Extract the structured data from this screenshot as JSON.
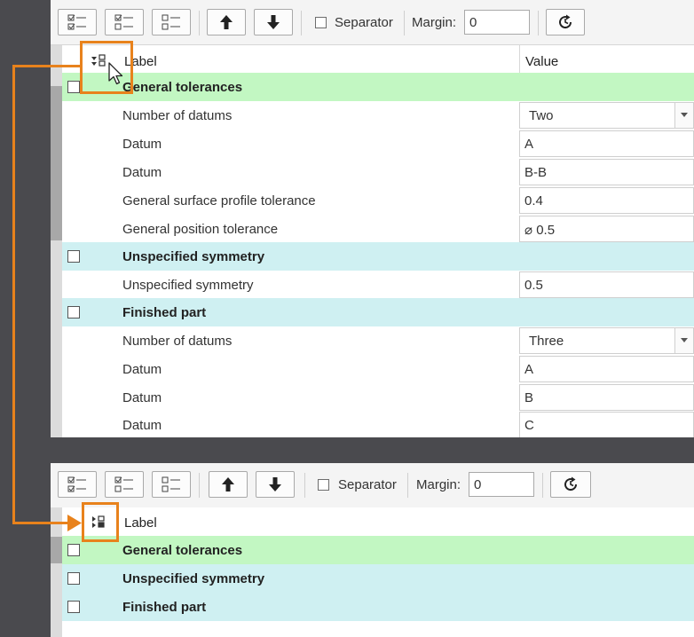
{
  "toolbar": {
    "separator_label": "Separator",
    "margin_label": "Margin:",
    "margin_value": "0"
  },
  "header": {
    "label": "Label",
    "value": "Value"
  },
  "groups_expanded": [
    {
      "label": "General tolerances",
      "color": "#c2f7c2",
      "props": [
        {
          "label": "Number of datums",
          "value": "Two",
          "type": "dropdown"
        },
        {
          "label": "Datum",
          "value": "A"
        },
        {
          "label": "Datum",
          "value": "B-B"
        },
        {
          "label": "General surface profile tolerance",
          "value": "0.4"
        },
        {
          "label": "General position tolerance",
          "value": "⌀ 0.5"
        }
      ]
    },
    {
      "label": "Unspecified symmetry",
      "color": "#cff0f2",
      "props": [
        {
          "label": "Unspecified symmetry",
          "value": "0.5"
        }
      ]
    },
    {
      "label": "Finished part",
      "color": "#cff0f2",
      "props": [
        {
          "label": "Number of datums",
          "value": "Three",
          "type": "dropdown"
        },
        {
          "label": "Datum",
          "value": "A"
        },
        {
          "label": "Datum",
          "value": "B"
        },
        {
          "label": "Datum",
          "value": "C"
        }
      ]
    }
  ],
  "groups_collapsed": [
    {
      "label": "General tolerances",
      "color": "#c2f7c2"
    },
    {
      "label": "Unspecified symmetry",
      "color": "#cff0f2"
    },
    {
      "label": "Finished part",
      "color": "#cff0f2"
    }
  ],
  "highlight_color": "#e8821c"
}
